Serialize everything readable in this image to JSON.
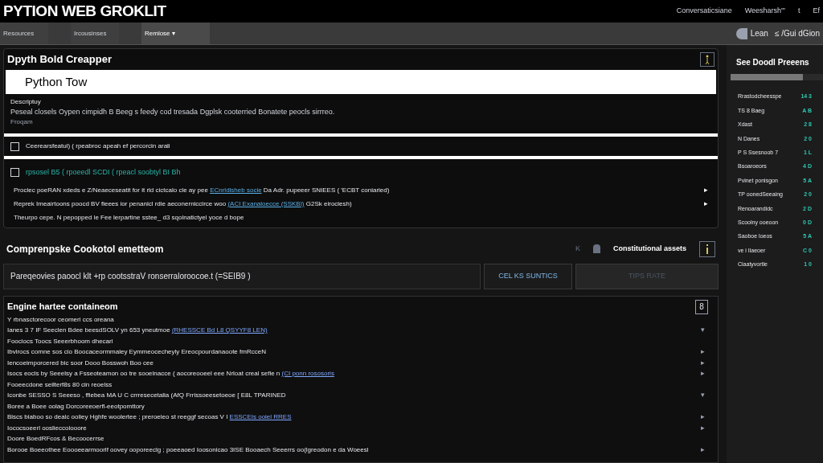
{
  "header": {
    "title": "PYTION WEB GROKLIT",
    "links": [
      "Conversaticsiane",
      "Weesharsh'\"",
      "t",
      "Ef"
    ]
  },
  "tabs": [
    {
      "label": "Resources",
      "selected": false
    },
    {
      "label": "Ircousinses",
      "selected": false
    },
    {
      "label": "Remlose",
      "selected": true,
      "caret": "▾"
    }
  ],
  "toolbar_right": {
    "login": "Lean",
    "guide": "≤ /Gui dGion"
  },
  "builder": {
    "title": "Dpyth Bold Creapper",
    "input_value": "Python Tow",
    "label": "Descriptuy",
    "paragraph": "Peseal closels Oypen cimpidh B Beeg s feedy cod tresada Dgplsk cooterried Bonatete peocls sirrreo.",
    "note": "Froqam",
    "option": {
      "label": "Ceerearsfeatul) ( rpeabroc apeah ef percorcin arali",
      "checked": false
    },
    "link_option": {
      "label": "rpsosel B5 ( rpoeedl SCDI ( rpeacl soobtyl BI Bh",
      "checked": false
    },
    "lines": [
      {
        "text": "Proclec poeRAN xdeds e Z/Neaeceseatit for it rld cictcalo cle ay pee",
        "link": "ECnrldlsheb socie",
        "tail": "Da Adr. pupeeer SNIEES ( 'ECBT coniaried)",
        "arrow": "▸"
      },
      {
        "text": "Reprek Imeairtoons poocd BV fieees ior penanicl rdie aeconerniccirce woo",
        "link": "(ACI Exanaloecce (SSKBI)",
        "tail": "G2Sk eirociesh)",
        "arrow": "▸"
      },
      {
        "text": "Theurpo cepe. N pepopped le Fee lerpartine sstee_ d3 sqolnatictyel yoce d bope"
      }
    ]
  },
  "components": {
    "title": "Comprenpske Cookotol emetteom",
    "arrow": "K",
    "right_label": "Constitutional assets",
    "field_value": "Pareqeovies paoocl klt +rp cootsstraV ronserraloroocoe.t (=SEIB9 )",
    "buttons": [
      {
        "label": "CEL KS SUNTICS",
        "disabled": false
      },
      {
        "label": "TIPS RATE",
        "disabled": true
      }
    ]
  },
  "engine": {
    "title": "Engine hartee containeom",
    "badge": "8",
    "rows": [
      {
        "text": "Y rbnasctorecoor ceomeri ccs oreana"
      },
      {
        "text": "Ianes 3 7 IF Seeclen Bdee beesdSOLV yn 653 yneutmoe",
        "link": "(RHESSCE Bd L8 QSYYF8 LEN)",
        "arrow": "▾"
      },
      {
        "text": "Fooclocs Toocs Seeerbhoom dhecarl"
      },
      {
        "text": "Ibvirocs comne sos cio Boocaceormmaley Eymmeocecheyly Ereocpourdanaoote fmRcceN",
        "arrow": "▸"
      },
      {
        "text": "Iencoeimporcered bic soor Dooo Bosswoh Boo cee",
        "arrow": "▸"
      },
      {
        "text": "Isocs eocls by Seeelsy a Fsseoteamon oo tre sooelnacce ( aocoreooeel eee Nrloat creal sefie n",
        "link": "(CI ponn rososoris",
        "arrow": "▸"
      },
      {
        "text": "Fooeecdone seilterf8s 80 cin reoelss"
      },
      {
        "text": "Iconbe SESSO S Seeeso , ffiebea MA U C crrresecetalia (AfQ Frrissoeesetoeoe [ E8L TPARINED",
        "arrow": "▾"
      },
      {
        "text": "Boree a Boee oolag Dorcoreeoerfl-eeotpomttory"
      },
      {
        "text": "Biscs biaboo so dealc ooliey Hghfe woolertee ; preroeleo st reeggf secoas V I",
        "link": "ESSCEIs ooiel RRES",
        "arrow": "▸"
      },
      {
        "text": "Iococsoeerl ooslieccolooore",
        "arrow": "▸"
      },
      {
        "text": "Doore BoedRFcos & Becoocerrse"
      },
      {
        "text": "Borooe Boeeothee Eoooeearmoorlf oovey ooporeeclg ; poeeaoed Ioosonicao 3ISE Booaech Seeerrs oo(lgreodon e da Woeesl",
        "arrow": "▸"
      }
    ]
  },
  "presets": {
    "title": "See Doodl Preeens",
    "level": 0.78,
    "items": [
      {
        "name": "Rrastodcheesspe",
        "value": "14 3"
      },
      {
        "name": "TS 8 Baeg",
        "value": "A B"
      },
      {
        "name": "Xdast",
        "value": "2 8"
      },
      {
        "name": "N Danes",
        "value": "2 0"
      },
      {
        "name": "P S Ssesnoob 7",
        "value": "1 L"
      },
      {
        "name": "Bsoaroeors",
        "value": "4 D"
      },
      {
        "name": "Pvinet ponisgon",
        "value": "5 A"
      },
      {
        "name": "TP oonedSeeaing",
        "value": "2 0"
      },
      {
        "name": "Renoarandidc",
        "value": "2 D"
      },
      {
        "name": "Scoolny ooeoon",
        "value": "0 D"
      },
      {
        "name": "Saoboe loeos",
        "value": "5 A"
      },
      {
        "name": "ve i Ilaeoer",
        "value": "C 0"
      },
      {
        "name": "Ciaatyvortle",
        "value": "1 0"
      }
    ]
  }
}
